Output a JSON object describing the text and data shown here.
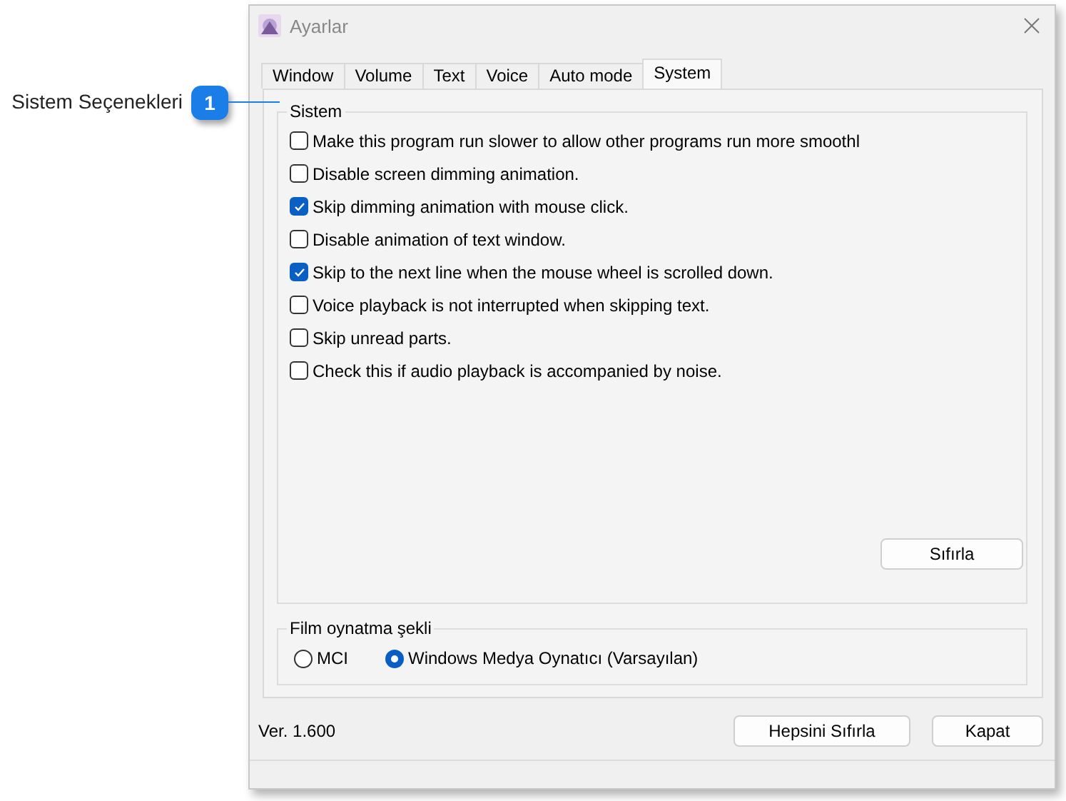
{
  "callout": {
    "number": "1",
    "label": "Sistem Seçenekleri"
  },
  "window": {
    "title": "Ayarlar"
  },
  "tabs": [
    {
      "label": "Window",
      "selected": false
    },
    {
      "label": "Volume",
      "selected": false
    },
    {
      "label": "Text",
      "selected": false
    },
    {
      "label": "Voice",
      "selected": false
    },
    {
      "label": "Auto mode",
      "selected": false
    },
    {
      "label": "System",
      "selected": true
    }
  ],
  "system_group": {
    "title": "Sistem",
    "options": [
      {
        "label": "Make this program run slower to allow other programs run more smoothl",
        "checked": false
      },
      {
        "label": "Disable screen dimming animation.",
        "checked": false
      },
      {
        "label": "Skip dimming animation with mouse click.",
        "checked": true
      },
      {
        "label": "Disable animation of text window.",
        "checked": false
      },
      {
        "label": "Skip to the next line when the mouse wheel is scrolled down.",
        "checked": true
      },
      {
        "label": "Voice playback is not interrupted when skipping text.",
        "checked": false
      },
      {
        "label": "Skip unread parts.",
        "checked": false
      },
      {
        "label": "Check this if audio playback is accompanied by noise.",
        "checked": false
      }
    ],
    "reset_button": "Sıfırla"
  },
  "movie_group": {
    "title": "Film oynatma şekli",
    "options": [
      {
        "label": "MCI",
        "selected": false
      },
      {
        "label": "Windows Medya Oynatıcı (Varsayılan)",
        "selected": true
      }
    ]
  },
  "version": "Ver. 1.600",
  "buttons": [
    "Hepsini Sıfırla",
    "Kapat"
  ]
}
